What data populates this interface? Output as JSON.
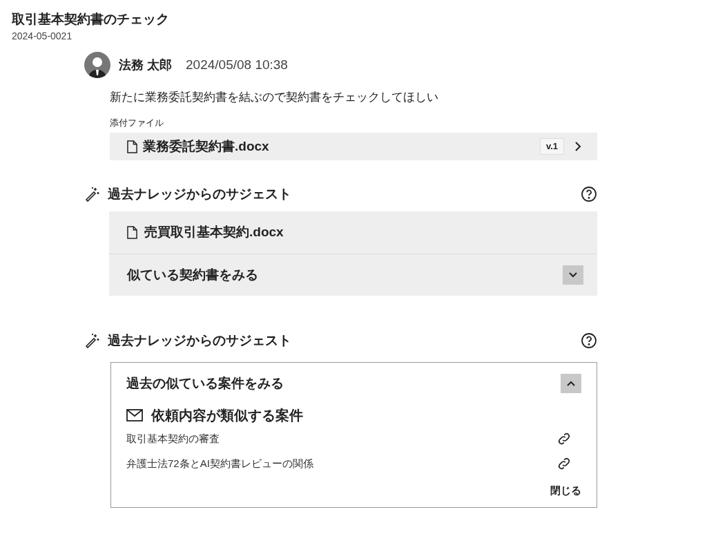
{
  "header": {
    "title": "取引基本契約書のチェック",
    "case_id": "2024-05-0021"
  },
  "message": {
    "author": "法務 太郎",
    "timestamp": "2024/05/08 10:38",
    "body": "新たに業務委託契約書を結ぶので契約書をチェックしてほしい",
    "attachments_label": "添付ファイル",
    "attachments": [
      {
        "name": "業務委託契約書.docx",
        "version": "v.1"
      }
    ]
  },
  "suggestions": [
    {
      "title": "過去ナレッジからのサジェスト",
      "file": "売買取引基本契約.docx",
      "toggle_label": "似ている契約書をみる",
      "expanded": false
    },
    {
      "title": "過去ナレッジからのサジェスト",
      "toggle_label": "過去の似ている案件をみる",
      "expanded": true,
      "group_title": "依頼内容が類似する案件",
      "cases": [
        "取引基本契約の審査",
        "弁護士法72条とAI契約書レビューの関係"
      ],
      "close_label": "閉じる"
    }
  ]
}
